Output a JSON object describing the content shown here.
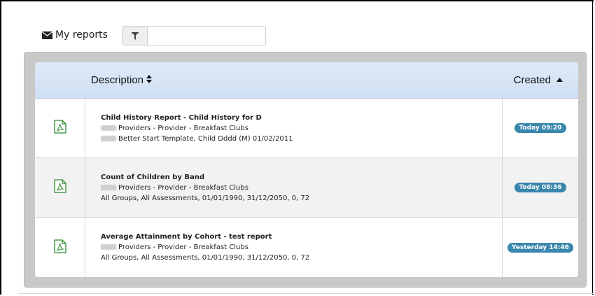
{
  "header": {
    "title": "My reports",
    "icon": "envelope-icon",
    "filter_icon": "filter-icon",
    "filter_value": ""
  },
  "table": {
    "columns": {
      "description": "Description",
      "created": "Created"
    },
    "rows": [
      {
        "icon": "pdf-icon",
        "title": "Child History Report - Child History for D",
        "line2": "Providers - Provider - Breakfast Clubs",
        "line3": "Better Start Template, Child Dddd (M) 01/02/2011",
        "created": "Today 09:20"
      },
      {
        "icon": "pdf-icon",
        "title": "Count of Children by Band",
        "line2": "Providers - Provider - Breakfast Clubs",
        "line3": "All Groups, All Assessments, 01/01/1990, 31/12/2050, 0, 72",
        "created": "Today 08:36"
      },
      {
        "icon": "pdf-icon",
        "title": "Average Attainment by Cohort - test report",
        "line2": "Providers - Provider - Breakfast Clubs",
        "line3": "All Groups, All Assessments, 01/01/1990, 31/12/2050, 0, 72",
        "created": "Yesterday 14:46"
      }
    ]
  },
  "colors": {
    "badge": "#3a87ad",
    "header_bg": "#dfeaf8",
    "pdf_icon": "#2e8b2e",
    "panel": "#c9c9c9"
  }
}
